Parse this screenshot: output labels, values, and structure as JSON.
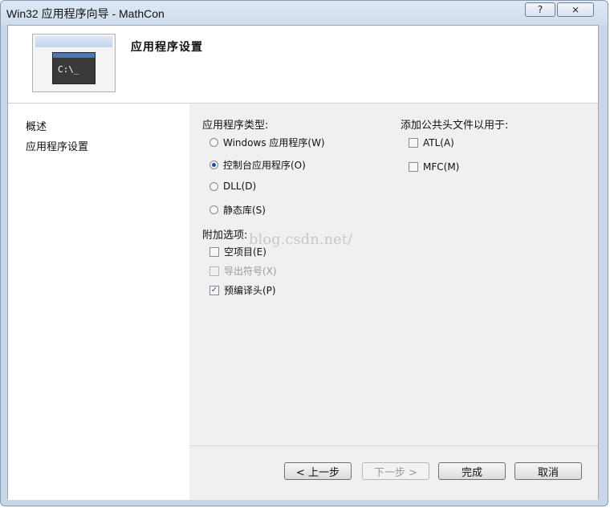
{
  "window": {
    "title": "Win32 应用程序向导 - MathCon",
    "help_glyph": "?",
    "close_glyph": "⨯"
  },
  "banner": {
    "title": "应用程序设置",
    "console_text": "C:\\_"
  },
  "nav": {
    "items": [
      "概述",
      "应用程序设置"
    ]
  },
  "app_type": {
    "label": "应用程序类型:",
    "options": [
      "Windows 应用程序(W)",
      "控制台应用程序(O)",
      "DLL(D)",
      "静态库(S)"
    ],
    "selected": "控制台应用程序(O)"
  },
  "extra": {
    "label": "附加选项:",
    "options": [
      "空项目(E)",
      "导出符号(X)",
      "预编译头(P)"
    ]
  },
  "common_headers": {
    "label": "添加公共头文件以用于:",
    "options": [
      "ATL(A)",
      "MFC(M)"
    ]
  },
  "watermark": "blog.csdn.net/",
  "buttons": {
    "back": "< 上一步",
    "next": "下一步 >",
    "finish": "完成",
    "cancel": "取消"
  }
}
